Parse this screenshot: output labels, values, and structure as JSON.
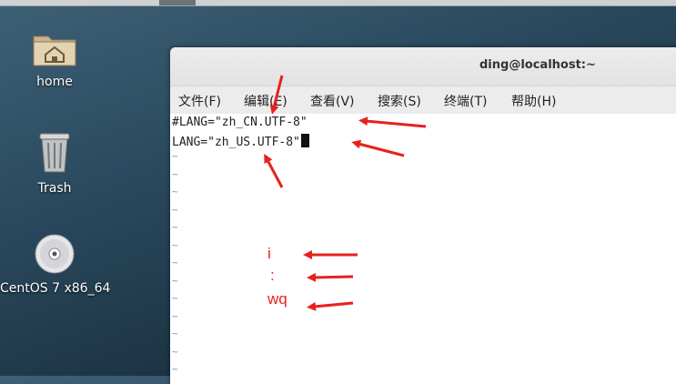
{
  "desktop": {
    "icons": [
      {
        "label": "home"
      },
      {
        "label": "Trash"
      },
      {
        "label": "CentOS 7 x86_64"
      }
    ]
  },
  "terminal": {
    "title": "ding@localhost:~",
    "menu": [
      {
        "label": "文件(F)"
      },
      {
        "label": "编辑(E)"
      },
      {
        "label": "查看(V)"
      },
      {
        "label": "搜索(S)"
      },
      {
        "label": "终端(T)"
      },
      {
        "label": "帮助(H)"
      }
    ],
    "lines": [
      "#LANG=\"zh_CN.UTF-8\"",
      "LANG=\"zh_US.UTF-8\""
    ],
    "empty_line_marker": "~"
  },
  "annotations": {
    "insert": "i",
    "colon": ":",
    "wq": "wq",
    "arrow_color": "#e8211d"
  },
  "colors": {
    "tilde": "#5aa0d8",
    "annotation": "#e8211d"
  }
}
